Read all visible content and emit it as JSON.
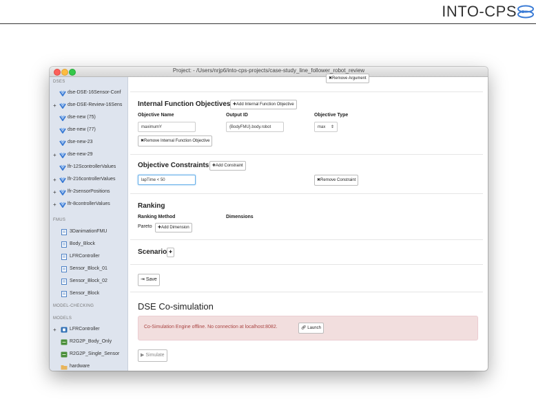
{
  "doc_header": {
    "brand": "INTO-CPS"
  },
  "window": {
    "title": "Project: - /Users/nrjp6/into-cps-projects/case-study_line_follower_robot_review"
  },
  "sidebar": {
    "dses_label": "DSES",
    "dses": [
      {
        "label": "dse-DSE-16Sensor-Conf",
        "expandable": false
      },
      {
        "label": "dse-DSE-Review-16Sens",
        "expandable": true
      },
      {
        "label": "dse-new (75)",
        "expandable": false
      },
      {
        "label": "dse-new (77)",
        "expandable": false
      },
      {
        "label": "dse-new-23",
        "expandable": false
      },
      {
        "label": "dse-new-29",
        "expandable": true
      },
      {
        "label": "lfr-12ScontrollerValues",
        "expandable": false
      },
      {
        "label": "lfr-216controllerValues",
        "expandable": true
      },
      {
        "label": "lfr-2sensorPositions",
        "expandable": true
      },
      {
        "label": "lfr-8controllerValues",
        "expandable": true
      }
    ],
    "fmus_label": "FMUS",
    "fmus": [
      "3DanimationFMU",
      "Body_Block",
      "LFRController",
      "Sensor_Block_01",
      "Sensor_Block_02",
      "Sensor_Block"
    ],
    "model_checking_label": "MODEL-CHECKING",
    "models_label": "MODELS",
    "models": [
      {
        "label": "LFRController",
        "expandable": true
      },
      {
        "label": "R2G2P_Body_Only",
        "expandable": false
      },
      {
        "label": "R2G2P_Single_Sensor",
        "expandable": false
      },
      {
        "label": "hardware",
        "expandable": false
      }
    ]
  },
  "main": {
    "remove_argument": "✖Remove Argument",
    "ifo": {
      "title": "Internal Function Objectives",
      "add_button": "✚Add Internal Function Objective",
      "col_name": "Objective Name",
      "col_output": "Output ID",
      "col_type": "Objective Type",
      "name_value": "maximumY",
      "output_value": "{BodyFMU}.body.robot",
      "type_value": "max",
      "remove_button": "✖Remove Internal Function Objective"
    },
    "constraints": {
      "title": "Objective Constraints",
      "add_button": "✚Add Constraint",
      "value": "lapTime < 50",
      "remove_button": "✖Remove Constraint"
    },
    "ranking": {
      "title": "Ranking",
      "method_label": "Ranking Method",
      "dimensions_label": "Dimensions",
      "method_value": "Pareto",
      "add_dimension": "✚Add Dimension"
    },
    "scenario": {
      "title": "Scenario",
      "add": "✚"
    },
    "save_button": "Save",
    "cosim": {
      "title": "DSE Co-simulation",
      "alert": "Co-Simulation Engine offline. No connection at localhost:8082.",
      "launch_button": "Launch",
      "simulate_button": "Simulate"
    }
  },
  "colors": {
    "accent": "#3a7bd5",
    "alert_bg": "#f2dede",
    "alert_text": "#a94442",
    "sidebar_bg": "#dee4ee"
  }
}
